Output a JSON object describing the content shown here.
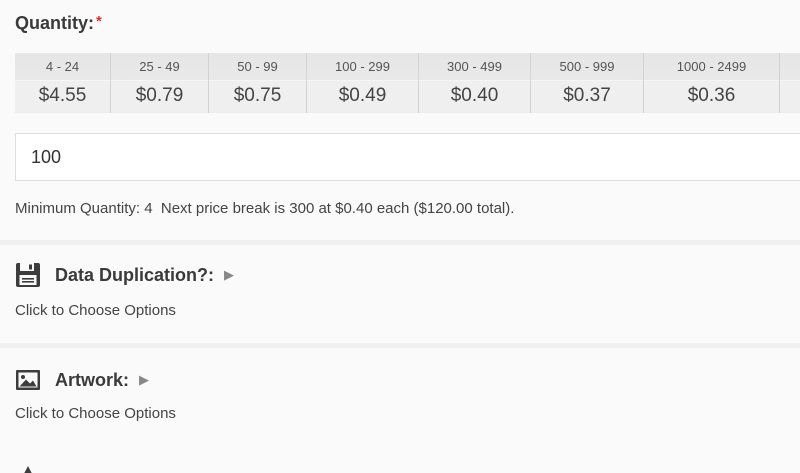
{
  "quantity": {
    "label": "Quantity:",
    "required_marker": "*"
  },
  "price_breaks": [
    {
      "range": "4 - 24",
      "price": "$4.55"
    },
    {
      "range": "25 - 49",
      "price": "$0.79"
    },
    {
      "range": "50 - 99",
      "price": "$0.75"
    },
    {
      "range": "100 - 299",
      "price": "$0.49"
    },
    {
      "range": "300 - 499",
      "price": "$0.40"
    },
    {
      "range": "500 - 999",
      "price": "$0.37"
    },
    {
      "range": "1000 - 2499",
      "price": "$0.36"
    }
  ],
  "quantity_input": {
    "value": "100"
  },
  "minimum_note": "Minimum Quantity: 4  Next price break is 300 at $0.40 each ($120.00 total).",
  "options": [
    {
      "title": "Data Duplication?:",
      "icon": "floppy-disk-icon",
      "link": "Click to Choose Options"
    },
    {
      "title": "Artwork:",
      "icon": "image-icon",
      "link": "Click to Choose Options"
    }
  ],
  "colors": {
    "required": "#d9302c",
    "heading": "#3a3a3a",
    "background": "#fafafa"
  }
}
